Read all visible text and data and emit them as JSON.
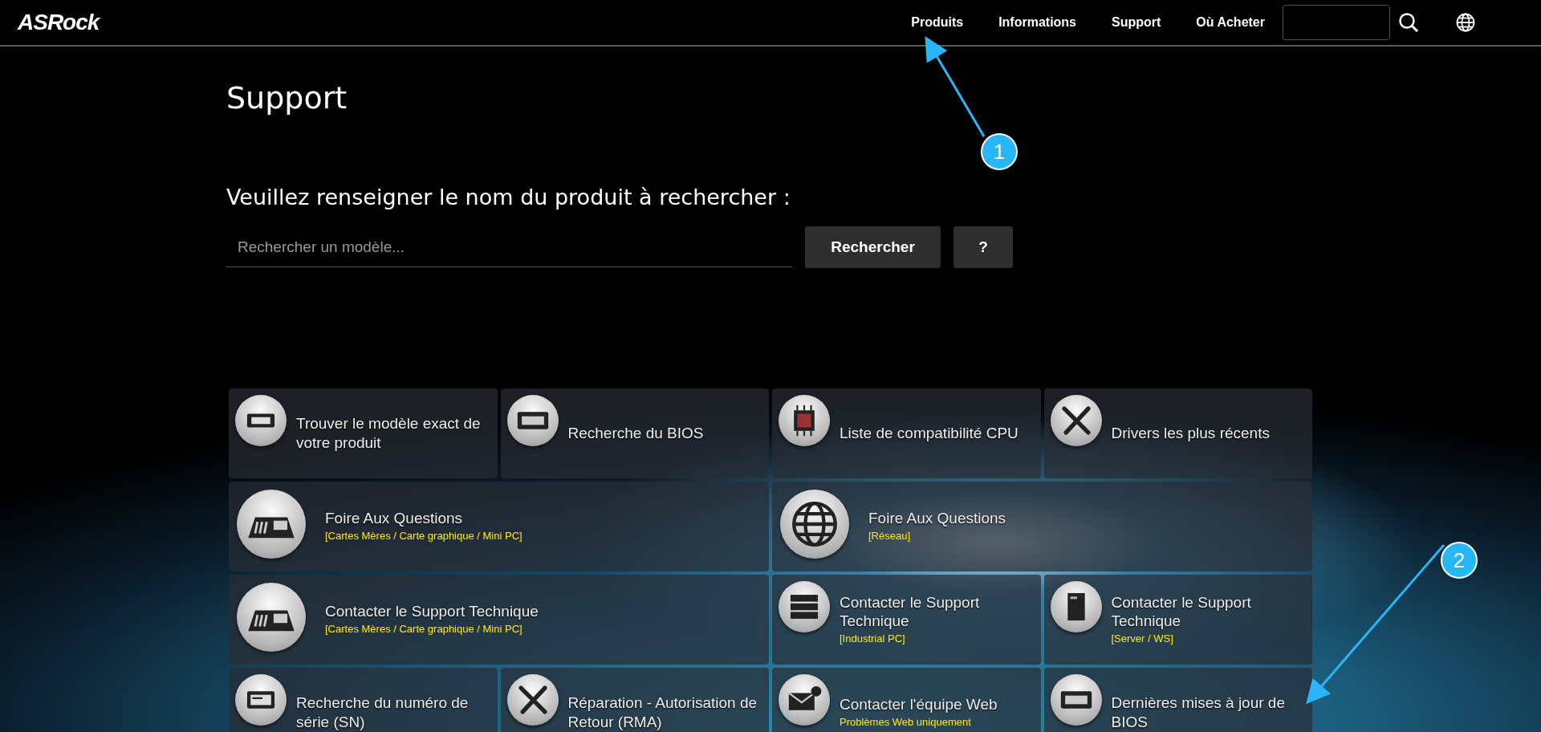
{
  "navbar": {
    "logo": "ASRock",
    "links": [
      "Produits",
      "Informations",
      "Support",
      "Où Acheter"
    ]
  },
  "page": {
    "title": "Support",
    "prompt": "Veuillez renseigner le nom du produit à rechercher :",
    "search": {
      "placeholder": "Rechercher un modèle..."
    },
    "buttons": [
      "Rechercher",
      "?"
    ]
  },
  "tiles": [
    {
      "kind": "small",
      "title": "Trouver le modèle exact de votre produit"
    },
    {
      "kind": "small",
      "title": "Recherche du BIOS"
    },
    {
      "kind": "small",
      "title": "Liste de compatibilité CPU"
    },
    {
      "kind": "small",
      "title": "Drivers les plus récents"
    },
    {
      "kind": "wide",
      "title": "Foire Aux Questions",
      "subtitle": "[Cartes Mères / Carte graphique / Mini PC]"
    },
    {
      "kind": "wide",
      "title": "Foire Aux Questions",
      "subtitle": "[Réseau]"
    },
    {
      "kind": "wide",
      "title": "Contacter le Support Technique",
      "subtitle": "[Cartes Mères / Carte graphique / Mini PC]"
    },
    {
      "kind": "small",
      "title": "Contacter le Support Technique",
      "subtitle": "[Industrial PC]"
    },
    {
      "kind": "small",
      "title": "Contacter le Support Technique",
      "subtitle": "[Server / WS]"
    },
    {
      "kind": "small",
      "title": "Recherche du numéro de série (SN)"
    },
    {
      "kind": "small",
      "title": "Réparation - Autorisation de Retour (RMA)"
    },
    {
      "kind": "small",
      "title": "Contacter l'équipe Web",
      "subtitle": "Problèmes Web uniquement"
    },
    {
      "kind": "small",
      "title": "Dernières mises à jour de BIOS"
    }
  ],
  "callouts": [
    "1",
    "2"
  ]
}
